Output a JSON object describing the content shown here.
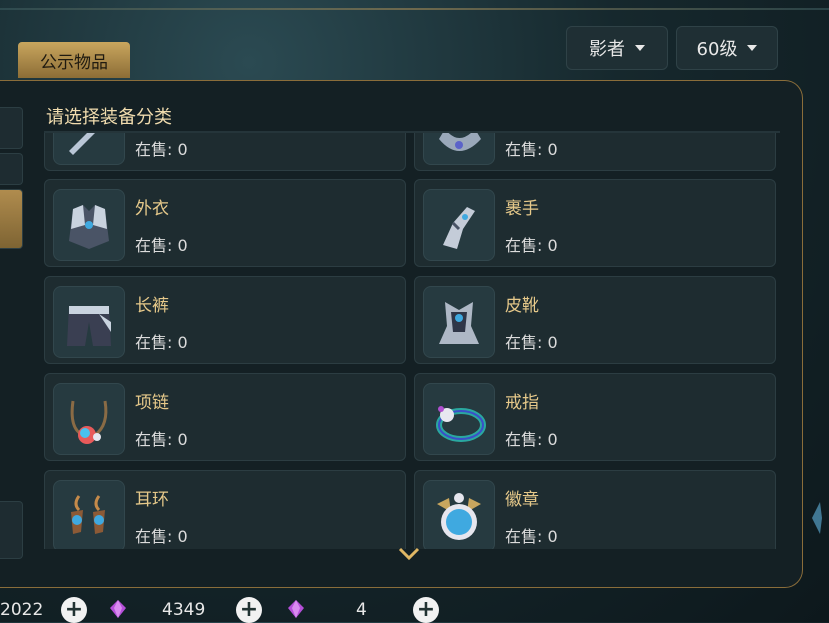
{
  "header": {
    "tab_label": "公示物品",
    "class_dropdown": "影者",
    "level_dropdown": "60级"
  },
  "panel": {
    "title": "请选择装备分类"
  },
  "categories": [
    {
      "name": "",
      "sale": "在售: 0",
      "icon": "weapon-icon"
    },
    {
      "name": "",
      "sale": "在售: 0",
      "icon": "shoulder-icon"
    },
    {
      "name": "外衣",
      "sale": "在售: 0",
      "icon": "chest-armor-icon"
    },
    {
      "name": "裹手",
      "sale": "在售: 0",
      "icon": "gauntlet-icon"
    },
    {
      "name": "长裤",
      "sale": "在售: 0",
      "icon": "pants-icon"
    },
    {
      "name": "皮靴",
      "sale": "在售: 0",
      "icon": "boots-icon"
    },
    {
      "name": "项链",
      "sale": "在售: 0",
      "icon": "necklace-icon"
    },
    {
      "name": "戒指",
      "sale": "在售: 0",
      "icon": "ring-icon"
    },
    {
      "name": "耳环",
      "sale": "在售: 0",
      "icon": "earring-icon"
    },
    {
      "name": "徽章",
      "sale": "在售: 0",
      "icon": "badge-icon"
    }
  ],
  "currency": {
    "gold": "2022",
    "diamond": "4349",
    "gem": "4"
  },
  "colors": {
    "accent_gold": "#c9a65e",
    "item_name": "#e6c98a",
    "panel_bg": "#142024"
  }
}
